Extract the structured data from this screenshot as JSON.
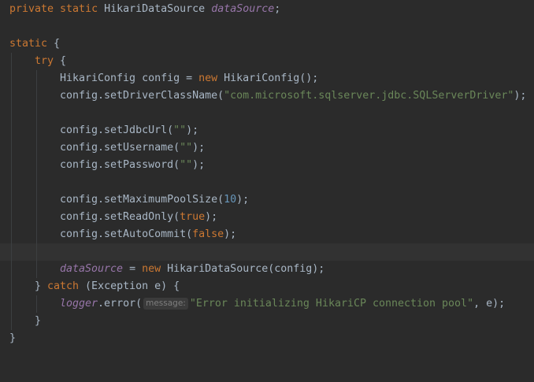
{
  "code": {
    "l1": {
      "kw": "private static ",
      "type": "HikariDataSource ",
      "field": "dataSource",
      "end": ";"
    },
    "l3": {
      "kw": "static",
      "end": " {"
    },
    "l4": {
      "kw": "try",
      "end": " {"
    },
    "l5": {
      "a": "HikariConfig config = ",
      "kw": "new",
      "b": " HikariConfig();"
    },
    "l6": {
      "a": "config.setDriverClassName(",
      "str": "\"com.microsoft.sqlserver.jdbc.SQLServerDriver\"",
      "b": ");"
    },
    "l8": {
      "a": "config.setJdbcUrl(",
      "str": "\"\"",
      "b": ");"
    },
    "l9": {
      "a": "config.setUsername(",
      "str": "\"\"",
      "b": ");"
    },
    "l10": {
      "a": "config.setPassword(",
      "str": "\"\"",
      "b": ");"
    },
    "l12": {
      "a": "config.setMaximumPoolSize(",
      "num": "10",
      "b": ");"
    },
    "l13": {
      "a": "config.setReadOnly(",
      "kw": "true",
      "b": ");"
    },
    "l14": {
      "a": "config.setAutoCommit(",
      "kw": "false",
      "b": ");"
    },
    "l16": {
      "field": "dataSource",
      "a": " = ",
      "kw": "new",
      "b": " HikariDataSource(config);"
    },
    "l17": {
      "a": "} ",
      "kw": "catch",
      "b": " (Exception e) {"
    },
    "l18": {
      "field": "logger",
      "a": ".error(",
      "hint": "message:",
      "str": "\"Error initializing HikariCP connection pool\"",
      "b": ", e);"
    },
    "l19": {
      "a": "}"
    },
    "l20": {
      "a": "}"
    }
  },
  "colors": {
    "background": "#2b2b2b",
    "keyword": "#cc7832",
    "string": "#6a8759",
    "number": "#6897bb",
    "field": "#9876aa",
    "text": "#a9b7c6",
    "current_line": "#323232"
  }
}
